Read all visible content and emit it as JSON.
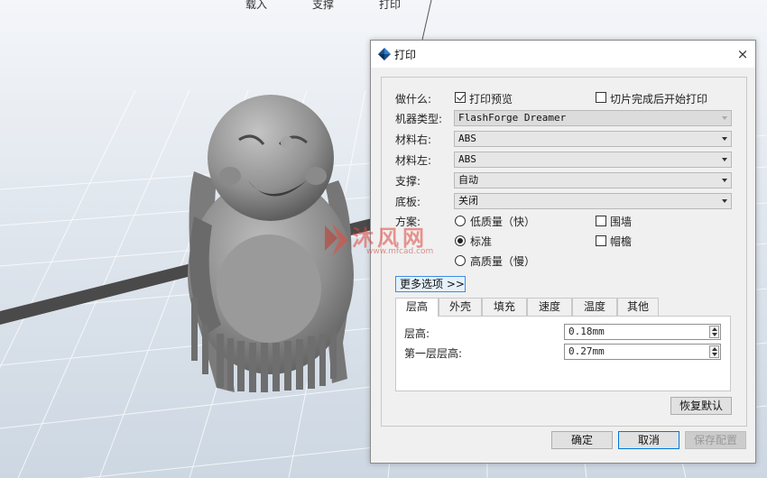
{
  "top_menu": [
    "载入",
    "支撑",
    "打印"
  ],
  "dialog": {
    "title": "打印",
    "close": "×",
    "what_label": "做什么:",
    "print_preview": "打印预览",
    "start_after_slice": "切片完成后开始打印",
    "machine_label": "机器类型:",
    "machine_value": "FlashForge Dreamer",
    "mat_right_label": "材料右:",
    "mat_right_value": "ABS",
    "mat_left_label": "材料左:",
    "mat_left_value": "ABS",
    "support_label": "支撑:",
    "support_value": "自动",
    "raft_label": "底板:",
    "raft_value": "关闭",
    "plan_label": "方案:",
    "low_quality": "低质量（快）",
    "standard": "标准",
    "high_quality": "高质量（慢）",
    "wall": "围墙",
    "brim": "帽檐",
    "more_options": "更多选项 >>",
    "tabs": [
      "层高",
      "外壳",
      "填充",
      "速度",
      "温度",
      "其他"
    ],
    "layer_height_label": "层高:",
    "layer_height_value": "0.18mm",
    "first_layer_label": "第一层层高:",
    "first_layer_value": "0.27mm",
    "restore_defaults": "恢复默认",
    "ok": "确定",
    "cancel": "取消",
    "save_config": "保存配置"
  },
  "watermark": {
    "text": "沐风网",
    "url": "www.mfcad.com"
  }
}
